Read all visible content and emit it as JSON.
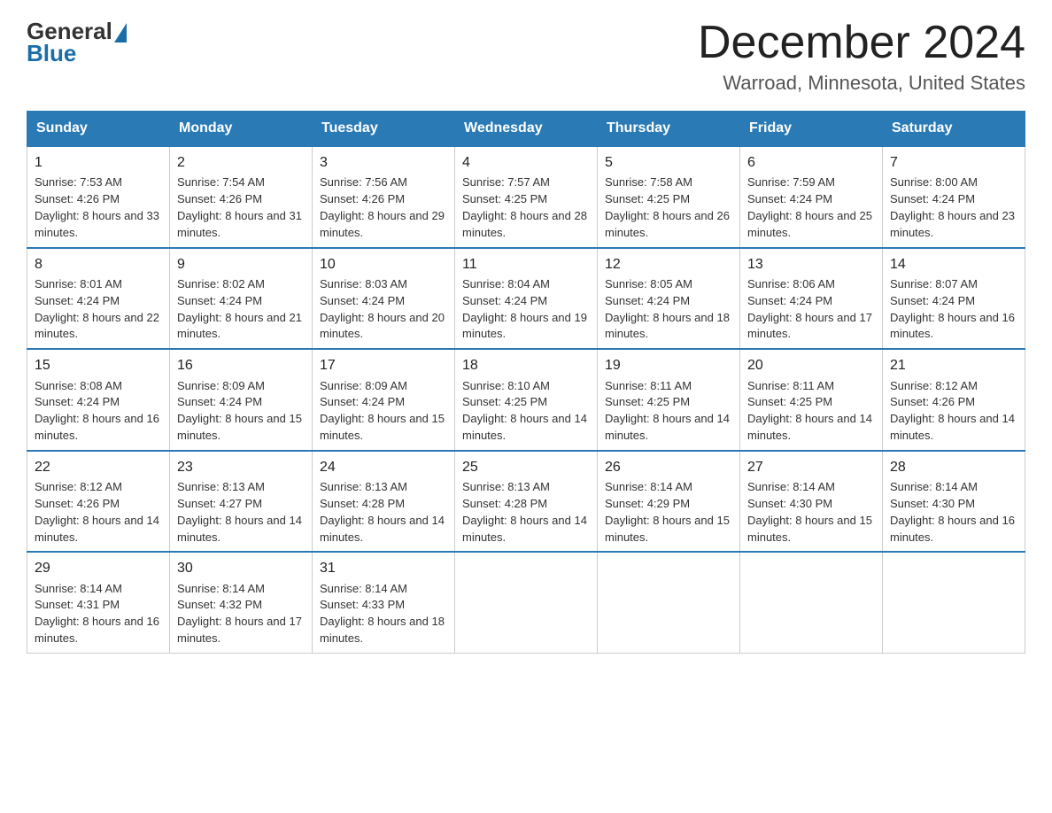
{
  "logo": {
    "general": "General",
    "blue": "Blue"
  },
  "title": "December 2024",
  "location": "Warroad, Minnesota, United States",
  "days_of_week": [
    "Sunday",
    "Monday",
    "Tuesday",
    "Wednesday",
    "Thursday",
    "Friday",
    "Saturday"
  ],
  "weeks": [
    [
      {
        "day": "1",
        "sunrise": "7:53 AM",
        "sunset": "4:26 PM",
        "daylight": "8 hours and 33 minutes."
      },
      {
        "day": "2",
        "sunrise": "7:54 AM",
        "sunset": "4:26 PM",
        "daylight": "8 hours and 31 minutes."
      },
      {
        "day": "3",
        "sunrise": "7:56 AM",
        "sunset": "4:26 PM",
        "daylight": "8 hours and 29 minutes."
      },
      {
        "day": "4",
        "sunrise": "7:57 AM",
        "sunset": "4:25 PM",
        "daylight": "8 hours and 28 minutes."
      },
      {
        "day": "5",
        "sunrise": "7:58 AM",
        "sunset": "4:25 PM",
        "daylight": "8 hours and 26 minutes."
      },
      {
        "day": "6",
        "sunrise": "7:59 AM",
        "sunset": "4:24 PM",
        "daylight": "8 hours and 25 minutes."
      },
      {
        "day": "7",
        "sunrise": "8:00 AM",
        "sunset": "4:24 PM",
        "daylight": "8 hours and 23 minutes."
      }
    ],
    [
      {
        "day": "8",
        "sunrise": "8:01 AM",
        "sunset": "4:24 PM",
        "daylight": "8 hours and 22 minutes."
      },
      {
        "day": "9",
        "sunrise": "8:02 AM",
        "sunset": "4:24 PM",
        "daylight": "8 hours and 21 minutes."
      },
      {
        "day": "10",
        "sunrise": "8:03 AM",
        "sunset": "4:24 PM",
        "daylight": "8 hours and 20 minutes."
      },
      {
        "day": "11",
        "sunrise": "8:04 AM",
        "sunset": "4:24 PM",
        "daylight": "8 hours and 19 minutes."
      },
      {
        "day": "12",
        "sunrise": "8:05 AM",
        "sunset": "4:24 PM",
        "daylight": "8 hours and 18 minutes."
      },
      {
        "day": "13",
        "sunrise": "8:06 AM",
        "sunset": "4:24 PM",
        "daylight": "8 hours and 17 minutes."
      },
      {
        "day": "14",
        "sunrise": "8:07 AM",
        "sunset": "4:24 PM",
        "daylight": "8 hours and 16 minutes."
      }
    ],
    [
      {
        "day": "15",
        "sunrise": "8:08 AM",
        "sunset": "4:24 PM",
        "daylight": "8 hours and 16 minutes."
      },
      {
        "day": "16",
        "sunrise": "8:09 AM",
        "sunset": "4:24 PM",
        "daylight": "8 hours and 15 minutes."
      },
      {
        "day": "17",
        "sunrise": "8:09 AM",
        "sunset": "4:24 PM",
        "daylight": "8 hours and 15 minutes."
      },
      {
        "day": "18",
        "sunrise": "8:10 AM",
        "sunset": "4:25 PM",
        "daylight": "8 hours and 14 minutes."
      },
      {
        "day": "19",
        "sunrise": "8:11 AM",
        "sunset": "4:25 PM",
        "daylight": "8 hours and 14 minutes."
      },
      {
        "day": "20",
        "sunrise": "8:11 AM",
        "sunset": "4:25 PM",
        "daylight": "8 hours and 14 minutes."
      },
      {
        "day": "21",
        "sunrise": "8:12 AM",
        "sunset": "4:26 PM",
        "daylight": "8 hours and 14 minutes."
      }
    ],
    [
      {
        "day": "22",
        "sunrise": "8:12 AM",
        "sunset": "4:26 PM",
        "daylight": "8 hours and 14 minutes."
      },
      {
        "day": "23",
        "sunrise": "8:13 AM",
        "sunset": "4:27 PM",
        "daylight": "8 hours and 14 minutes."
      },
      {
        "day": "24",
        "sunrise": "8:13 AM",
        "sunset": "4:28 PM",
        "daylight": "8 hours and 14 minutes."
      },
      {
        "day": "25",
        "sunrise": "8:13 AM",
        "sunset": "4:28 PM",
        "daylight": "8 hours and 14 minutes."
      },
      {
        "day": "26",
        "sunrise": "8:14 AM",
        "sunset": "4:29 PM",
        "daylight": "8 hours and 15 minutes."
      },
      {
        "day": "27",
        "sunrise": "8:14 AM",
        "sunset": "4:30 PM",
        "daylight": "8 hours and 15 minutes."
      },
      {
        "day": "28",
        "sunrise": "8:14 AM",
        "sunset": "4:30 PM",
        "daylight": "8 hours and 16 minutes."
      }
    ],
    [
      {
        "day": "29",
        "sunrise": "8:14 AM",
        "sunset": "4:31 PM",
        "daylight": "8 hours and 16 minutes."
      },
      {
        "day": "30",
        "sunrise": "8:14 AM",
        "sunset": "4:32 PM",
        "daylight": "8 hours and 17 minutes."
      },
      {
        "day": "31",
        "sunrise": "8:14 AM",
        "sunset": "4:33 PM",
        "daylight": "8 hours and 18 minutes."
      },
      null,
      null,
      null,
      null
    ]
  ]
}
